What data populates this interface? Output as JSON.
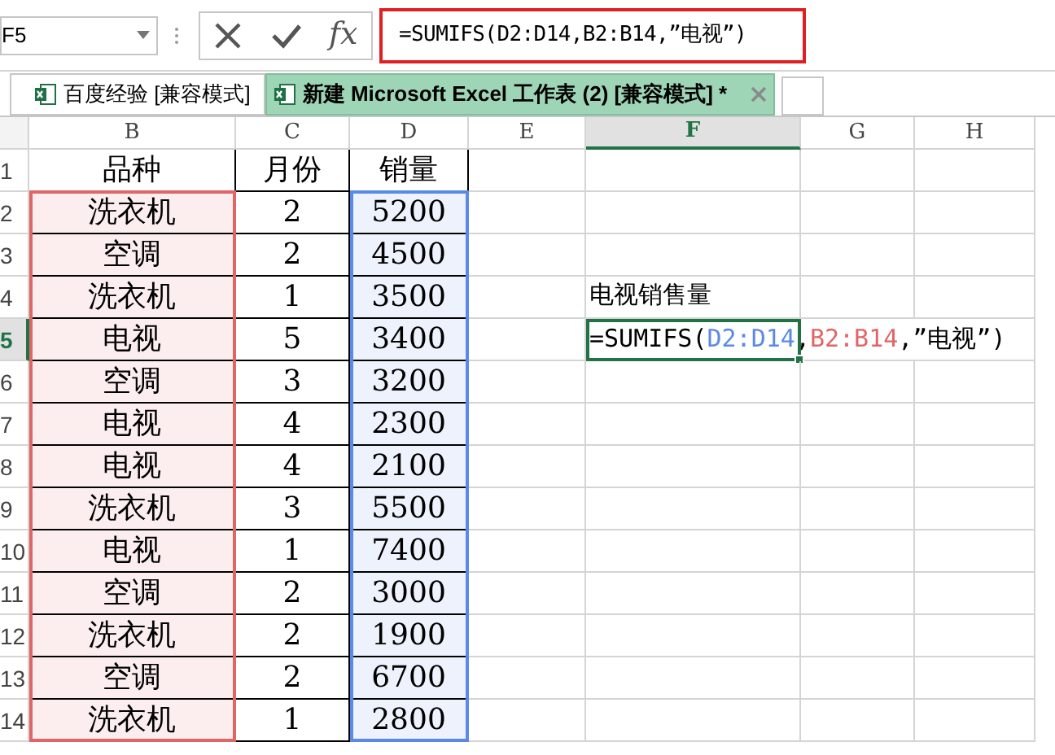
{
  "name_box": "F5",
  "formula_bar": {
    "fx_label": "fx",
    "formula": "=SUMIFS(D2:D14,B2:B14,”电视”)"
  },
  "tabs": [
    {
      "label": "百度经验  [兼容模式]",
      "selected": false
    },
    {
      "label": "新建 Microsoft Excel 工作表 (2)  [兼容模式] *",
      "selected": true
    }
  ],
  "columns": [
    {
      "letter": "B",
      "selected": false,
      "color": "#e06666"
    },
    {
      "letter": "C",
      "selected": false
    },
    {
      "letter": "D",
      "selected": false,
      "color": "#5b8ae6"
    },
    {
      "letter": "E",
      "selected": false
    },
    {
      "letter": "F",
      "selected": true
    },
    {
      "letter": "G",
      "selected": false
    },
    {
      "letter": "H",
      "selected": false
    }
  ],
  "rows": [
    {
      "number": "1",
      "selected": false,
      "cells": [
        "品种",
        "月份",
        "销量"
      ]
    },
    {
      "number": "2",
      "selected": false,
      "cells": [
        "洗衣机",
        "2",
        "5200"
      ]
    },
    {
      "number": "3",
      "selected": false,
      "cells": [
        "空调",
        "2",
        "4500"
      ]
    },
    {
      "number": "4",
      "selected": false,
      "cells": [
        "洗衣机",
        "1",
        "3500"
      ]
    },
    {
      "number": "5",
      "selected": true,
      "cells": [
        "电视",
        "5",
        "3400"
      ]
    },
    {
      "number": "6",
      "selected": false,
      "cells": [
        "空调",
        "3",
        "3200"
      ]
    },
    {
      "number": "7",
      "selected": false,
      "cells": [
        "电视",
        "4",
        "2300"
      ]
    },
    {
      "number": "8",
      "selected": false,
      "cells": [
        "电视",
        "4",
        "2100"
      ]
    },
    {
      "number": "9",
      "selected": false,
      "cells": [
        "洗衣机",
        "3",
        "5500"
      ]
    },
    {
      "number": "10",
      "selected": false,
      "cells": [
        "电视",
        "1",
        "7400"
      ]
    },
    {
      "number": "11",
      "selected": false,
      "cells": [
        "空调",
        "2",
        "3000"
      ]
    },
    {
      "number": "12",
      "selected": false,
      "cells": [
        "洗衣机",
        "2",
        "1900"
      ]
    },
    {
      "number": "13",
      "selected": false,
      "cells": [
        "空调",
        "2",
        "6700"
      ]
    },
    {
      "number": "14",
      "selected": false,
      "cells": [
        "洗衣机",
        "1",
        "2800"
      ]
    }
  ],
  "f4_label": "电视销售量",
  "f5_formula": [
    {
      "text": "=SUMIFS("
    },
    {
      "text": "D2:D14",
      "color": "#5b8ae6"
    },
    {
      "text": ","
    },
    {
      "text": "B2:B14",
      "color": "#e06666"
    },
    {
      "text": ",”电视”)"
    }
  ]
}
